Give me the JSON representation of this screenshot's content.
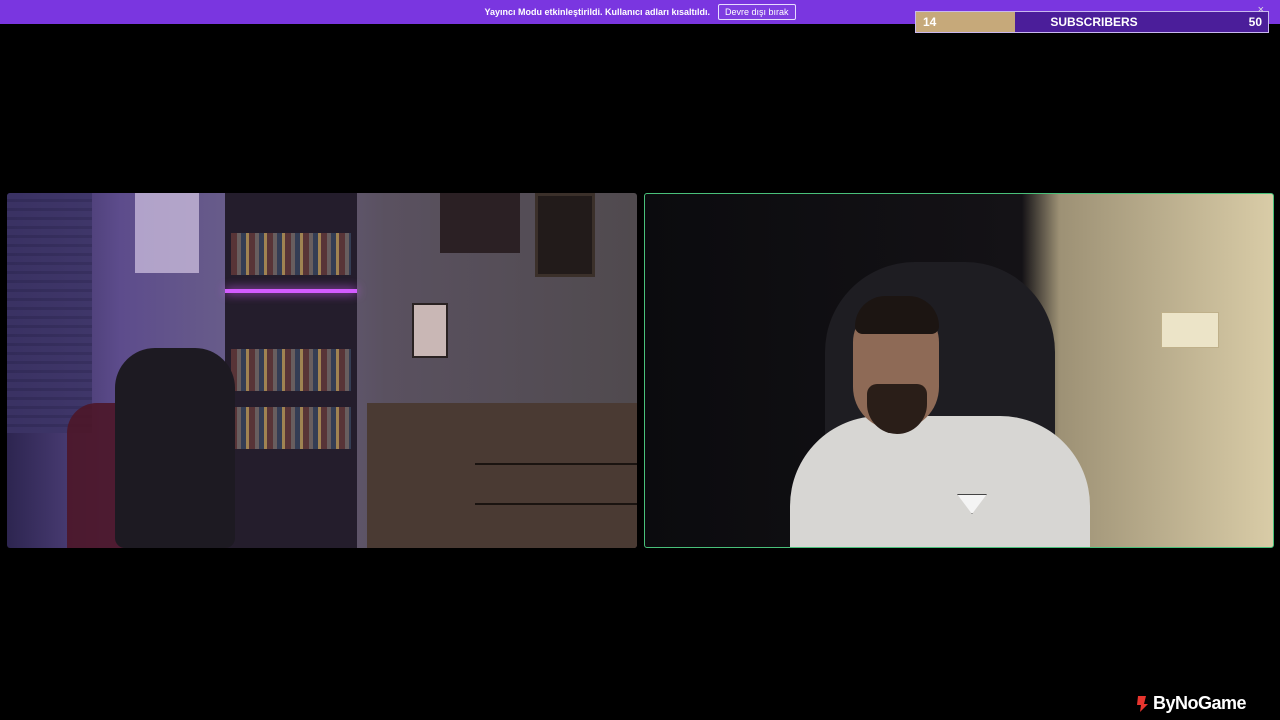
{
  "banner": {
    "message": "Yayıncı Modu etkinleştirildi. Kullanıcı adları kısaltıldı.",
    "disable_button": "Devre dışı bırak"
  },
  "goal_bar": {
    "current": "14",
    "label": "SUBSCRIBERS",
    "target": "50",
    "progress": 0.28,
    "close_glyph": "×"
  },
  "branding": {
    "name": "ByNoGame",
    "icon": "bynogame-logo-icon"
  },
  "colors": {
    "banner_purple": "#7a36e0",
    "goal_fill": "#c6a97a",
    "goal_bg": "#4b1e9a",
    "active_speaker_border": "#49c07a"
  }
}
